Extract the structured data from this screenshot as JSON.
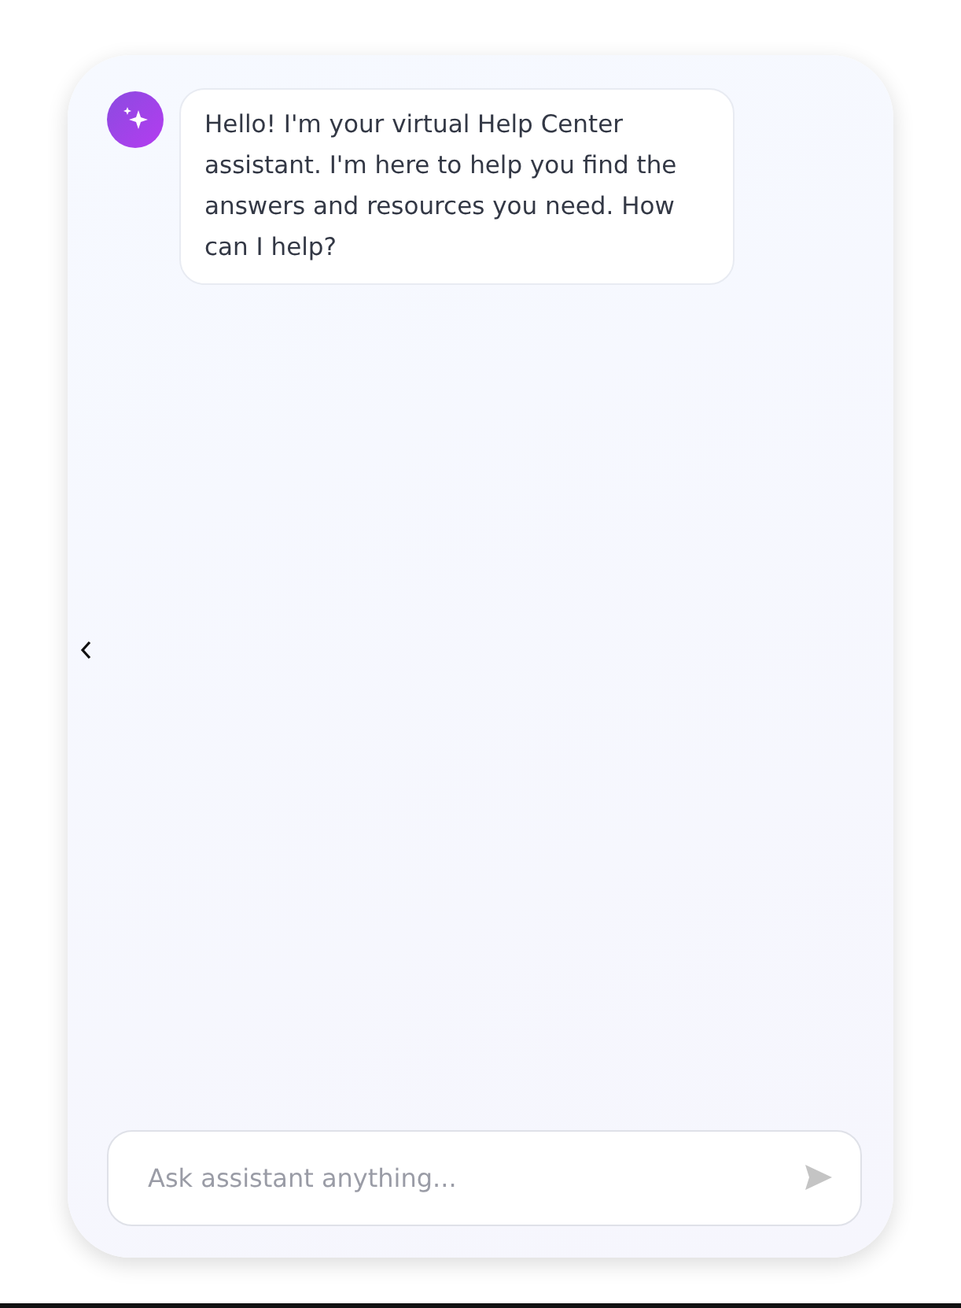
{
  "messages": [
    {
      "text": "Hello! I'm your virtual Help Center assistant. I'm here to help you find the answers and resources you need. How can I help?"
    }
  ],
  "composer": {
    "placeholder": "Ask assistant anything..."
  }
}
